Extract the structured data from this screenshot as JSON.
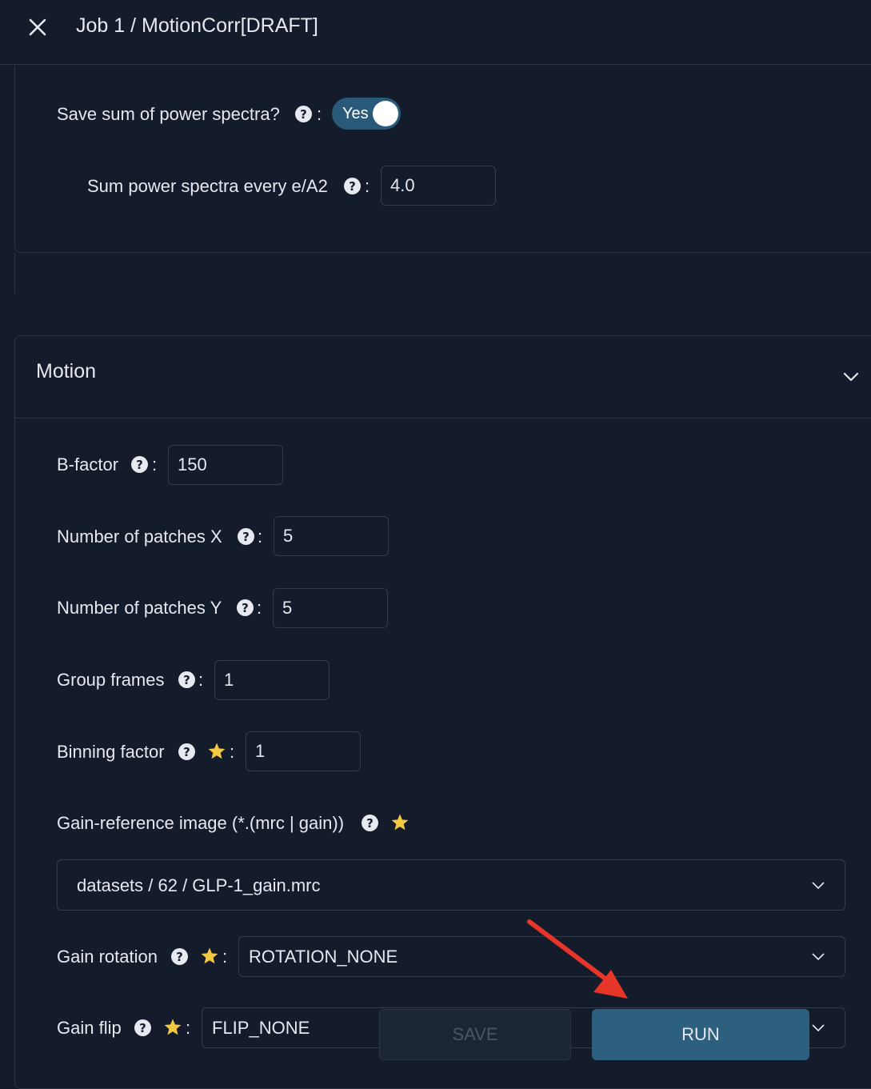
{
  "header": {
    "title": "Job 1 / MotionCorr[DRAFT]"
  },
  "top_section": {
    "save_power_spectra": {
      "label": "Save sum of power spectra?",
      "toggle_label": "Yes"
    },
    "sum_power_spectra_every": {
      "label": "Sum power spectra every e/A2",
      "value": "4.0"
    }
  },
  "motion": {
    "title": "Motion",
    "b_factor": {
      "label": "B-factor",
      "value": "150"
    },
    "patches_x": {
      "label": "Number of patches X",
      "value": "5"
    },
    "patches_y": {
      "label": "Number of patches Y",
      "value": "5"
    },
    "group_frames": {
      "label": "Group frames",
      "value": "1"
    },
    "binning_factor": {
      "label": "Binning factor",
      "value": "1"
    },
    "gain_reference": {
      "label": "Gain-reference image (*.(mrc | gain))",
      "value": "datasets / 62 / GLP-1_gain.mrc"
    },
    "gain_rotation": {
      "label": "Gain rotation",
      "value": "ROTATION_NONE"
    },
    "gain_flip": {
      "label": "Gain flip",
      "value": "FLIP_NONE"
    }
  },
  "common": {
    "colon": ":",
    "help_glyph": "?"
  },
  "actions": {
    "save_label": "SAVE",
    "run_label": "RUN"
  },
  "colors": {
    "accent": "#2d5f7e",
    "background": "#141b2b",
    "star": "#f5c842",
    "arrow": "#e8352a"
  }
}
